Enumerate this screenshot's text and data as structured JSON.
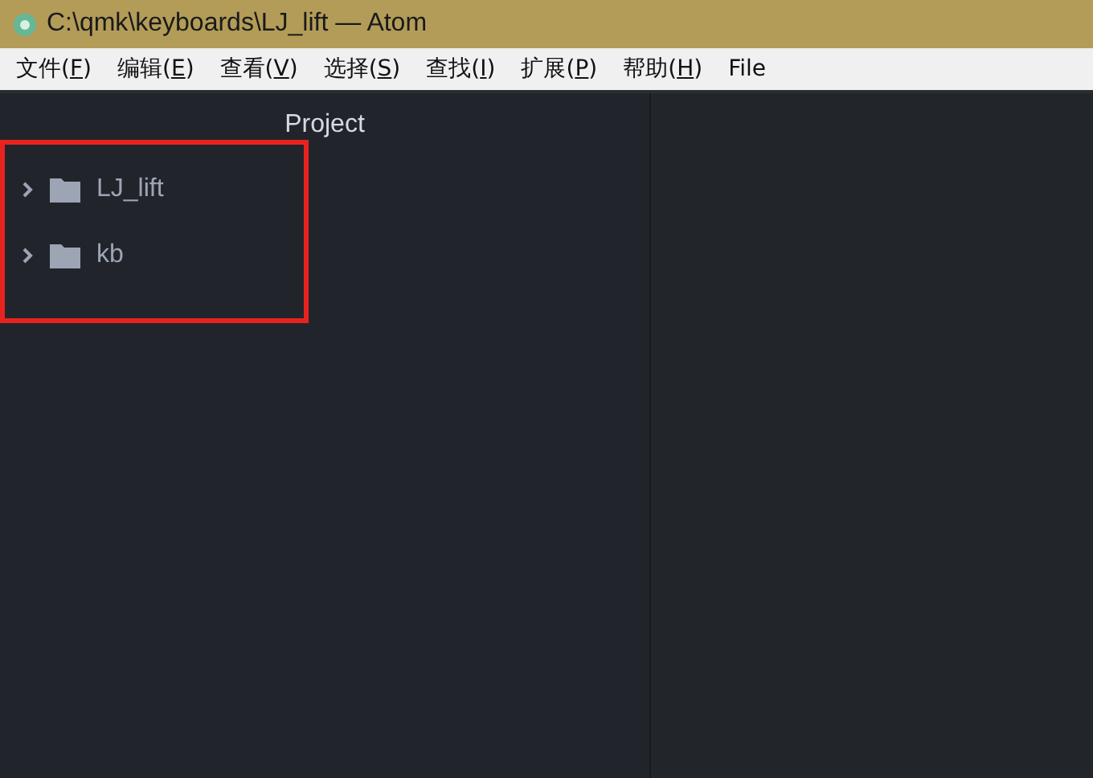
{
  "window": {
    "title": "C:\\qmk\\keyboards\\LJ_lift — Atom"
  },
  "menu": [
    {
      "before": "文件(",
      "key": "F",
      "after": ")"
    },
    {
      "before": "编辑(",
      "key": "E",
      "after": ")"
    },
    {
      "before": "查看(",
      "key": "V",
      "after": ")"
    },
    {
      "before": "选择(",
      "key": "S",
      "after": ")"
    },
    {
      "before": "查找(",
      "key": "I",
      "after": ")"
    },
    {
      "before": "扩展(",
      "key": "P",
      "after": ")"
    },
    {
      "before": "帮助(",
      "key": "H",
      "after": ")"
    },
    {
      "before": "File"
    }
  ],
  "tree_view": {
    "title": "Project",
    "highlight": {
      "color": "#e8231f"
    },
    "items": [
      {
        "name": "LJ_lift",
        "expanded": false
      },
      {
        "name": "kb",
        "expanded": false
      }
    ]
  }
}
